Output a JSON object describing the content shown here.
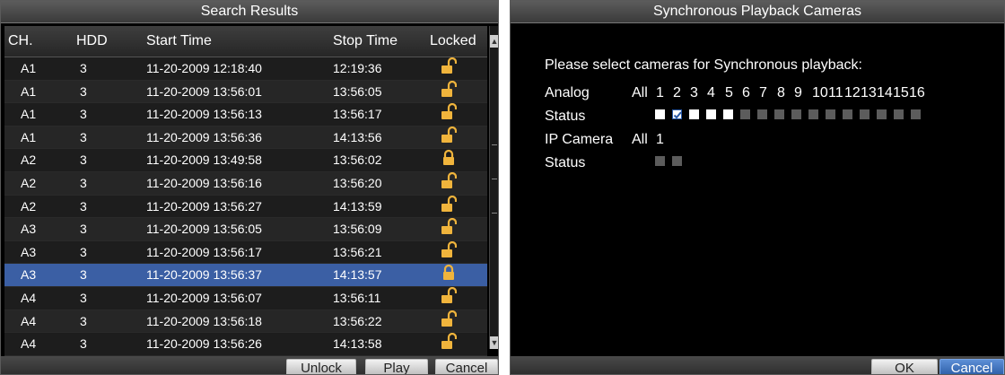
{
  "search_results": {
    "title": "Search Results",
    "columns": [
      "CH.",
      "HDD",
      "Start Time",
      "Stop Time",
      "Locked"
    ],
    "rows": [
      {
        "ch": "A1",
        "hdd": "3",
        "start": "11-20-2009 12:18:40",
        "stop": "12:19:36",
        "locked": false
      },
      {
        "ch": "A1",
        "hdd": "3",
        "start": "11-20-2009 13:56:01",
        "stop": "13:56:05",
        "locked": false
      },
      {
        "ch": "A1",
        "hdd": "3",
        "start": "11-20-2009 13:56:13",
        "stop": "13:56:17",
        "locked": false
      },
      {
        "ch": "A1",
        "hdd": "3",
        "start": "11-20-2009 13:56:36",
        "stop": "14:13:56",
        "locked": false
      },
      {
        "ch": "A2",
        "hdd": "3",
        "start": "11-20-2009 13:49:58",
        "stop": "13:56:02",
        "locked": true
      },
      {
        "ch": "A2",
        "hdd": "3",
        "start": "11-20-2009 13:56:16",
        "stop": "13:56:20",
        "locked": false
      },
      {
        "ch": "A2",
        "hdd": "3",
        "start": "11-20-2009 13:56:27",
        "stop": "14:13:59",
        "locked": false
      },
      {
        "ch": "A3",
        "hdd": "3",
        "start": "11-20-2009 13:56:05",
        "stop": "13:56:09",
        "locked": false
      },
      {
        "ch": "A3",
        "hdd": "3",
        "start": "11-20-2009 13:56:17",
        "stop": "13:56:21",
        "locked": false
      },
      {
        "ch": "A3",
        "hdd": "3",
        "start": "11-20-2009 13:56:37",
        "stop": "14:13:57",
        "locked": true,
        "selected": true
      },
      {
        "ch": "A4",
        "hdd": "3",
        "start": "11-20-2009 13:56:07",
        "stop": "13:56:11",
        "locked": false
      },
      {
        "ch": "A4",
        "hdd": "3",
        "start": "11-20-2009 13:56:18",
        "stop": "13:56:22",
        "locked": false
      },
      {
        "ch": "A4",
        "hdd": "3",
        "start": "11-20-2009 13:56:26",
        "stop": "14:13:58",
        "locked": false
      }
    ],
    "buttons": {
      "unlock": "Unlock",
      "play": "Play",
      "cancel": "Cancel"
    }
  },
  "sync_playback": {
    "title": "Synchronous Playback Cameras",
    "prompt": "Please select cameras for Synchronous playback:",
    "analog_label": "Analog",
    "status_label": "Status",
    "ip_label": "IP Camera",
    "ip_status_label": "Status",
    "analog_all": "All",
    "analog_channels": [
      "1",
      "2",
      "3",
      "4",
      "5",
      "6",
      "7",
      "8",
      "9",
      "10",
      "11",
      "12",
      "13",
      "14",
      "15",
      "16"
    ],
    "analog_status": [
      "on",
      "checked",
      "on",
      "on",
      "on",
      "off",
      "off",
      "off",
      "off",
      "off",
      "off",
      "off",
      "off",
      "off",
      "off",
      "off"
    ],
    "ip_all": "All",
    "ip_channels": [
      "1"
    ],
    "ip_status": [
      "off",
      "off"
    ],
    "buttons": {
      "ok": "OK",
      "cancel": "Cancel"
    }
  },
  "colors": {
    "selected_row": "#3b5fa4",
    "lock_icon": "#f0b43c",
    "checked_border": "#2a5aa8"
  }
}
